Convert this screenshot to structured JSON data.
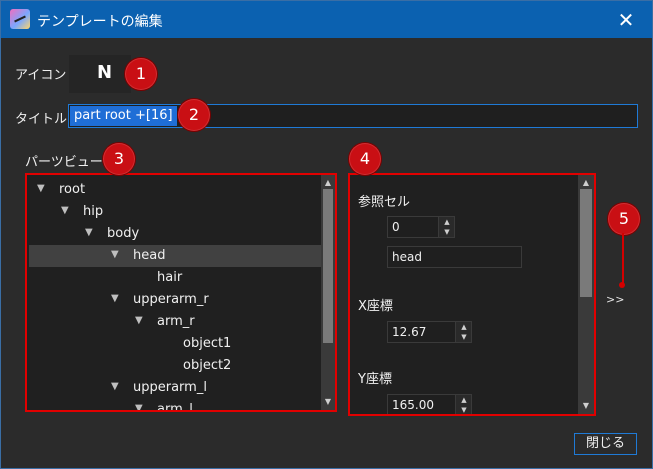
{
  "window": {
    "title": "テンプレートの編集",
    "close_glyph": "✕"
  },
  "form": {
    "icon_label": "アイコン",
    "icon_letter": "N",
    "title_label": "タイトル",
    "title_value": "part root +[16]"
  },
  "parts_view": {
    "label": "パーツビュー",
    "nodes": [
      {
        "label": "root",
        "expanded": true
      },
      {
        "label": "hip",
        "expanded": true
      },
      {
        "label": "body",
        "expanded": true
      },
      {
        "label": "head",
        "expanded": true,
        "selected": true
      },
      {
        "label": "hair"
      },
      {
        "label": "upperarm_r",
        "expanded": true
      },
      {
        "label": "arm_r",
        "expanded": true
      },
      {
        "label": "object1"
      },
      {
        "label": "object2"
      },
      {
        "label": "upperarm_l",
        "expanded": true
      },
      {
        "label": "arm_l",
        "expanded": true
      }
    ]
  },
  "properties": {
    "ref_cell_label": "参照セル",
    "ref_cell_value": "0",
    "ref_cell_name": "head",
    "x_label": "X座標",
    "x_value": "12.67",
    "y_label": "Y座標",
    "y_value": "165.00"
  },
  "expand_button": ">>",
  "footer": {
    "close_button": "閉じる"
  },
  "annotations": [
    "1",
    "2",
    "3",
    "4",
    "5"
  ],
  "colors": {
    "accent": "#0b61b0",
    "highlight": "#e10000"
  }
}
